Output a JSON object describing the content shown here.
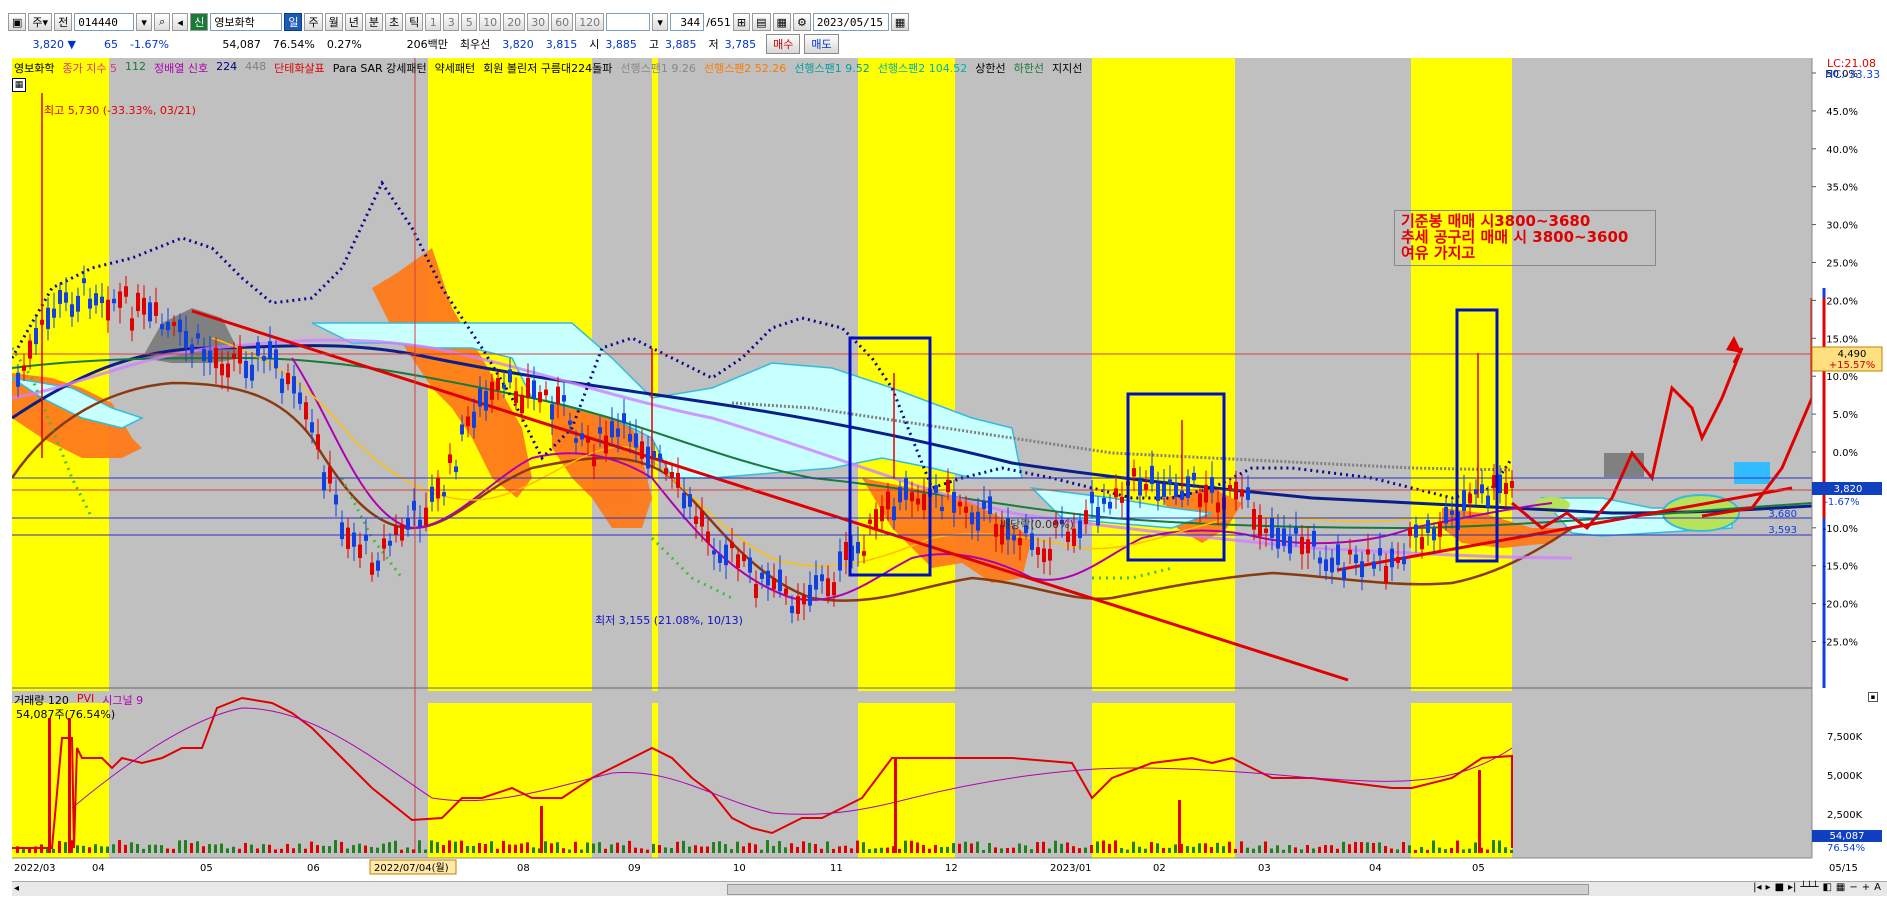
{
  "toolbar": {
    "period_buttons": [
      "주",
      "전"
    ],
    "code": "014440",
    "market_badge": "신",
    "stock_name": "영보화학",
    "interval_buttons": [
      "일",
      "주",
      "월",
      "년",
      "분",
      "초",
      "틱"
    ],
    "interval_numbers": [
      "1",
      "3",
      "5",
      "10",
      "20",
      "30",
      "60",
      "120"
    ],
    "count": "344",
    "total": "651",
    "date": "2023/05/15"
  },
  "info": {
    "price": "3,820 ▼",
    "change": "65",
    "change_pct": "-1.67%",
    "volume": "54,087",
    "vol_pct": "76.54%",
    "vol_change": "0.27%",
    "amount": "206백만",
    "quote": "최우선",
    "q1": "3,820",
    "q2": "3,815",
    "open_label": "시",
    "open": "3,885",
    "high_label": "고",
    "high": "3,885",
    "low_label": "저",
    "low": "3,785",
    "buy": "매수",
    "sell": "매도"
  },
  "legend": [
    {
      "text": "영보화학",
      "color": "#000000"
    },
    {
      "text": "종가 지수 5",
      "color": "#d63384"
    },
    {
      "text": "112",
      "color": "#1a7a3a"
    },
    {
      "text": "정배열 신호",
      "color": "#b000b0"
    },
    {
      "text": "224",
      "color": "#000080"
    },
    {
      "text": "448",
      "color": "#808080"
    },
    {
      "text": "단테화살표",
      "color": "#e00000"
    },
    {
      "text": "Para SAR 강세패턴",
      "color": "#000000"
    },
    {
      "text": "약세패턴",
      "color": "#000000"
    },
    {
      "text": "회원 볼린저 구름대224돌파",
      "color": "#000000"
    },
    {
      "text": "선행스팬1 9.26",
      "color": "#888888"
    },
    {
      "text": "선행스팬2 52.26",
      "color": "#ff7a00"
    },
    {
      "text": "선행스팬1 9.52",
      "color": "#00a0a0"
    },
    {
      "text": "선행스팬2 104.52",
      "color": "#00b0b0"
    },
    {
      "text": "상한선",
      "color": "#000000"
    },
    {
      "text": "하한선",
      "color": "#1a7a3a"
    },
    {
      "text": "지지선",
      "color": "#000000"
    }
  ],
  "legend_volume": [
    {
      "text": "거래량 120",
      "color": "#000000"
    },
    {
      "text": "PVI",
      "color": "#e00000"
    },
    {
      "text": "시그널 9",
      "color": "#b000b0"
    }
  ],
  "volume_readout": "54,087주(76.54%)",
  "annotations": {
    "high": "최고 5,730 (-33.33%, 03/21)",
    "low": "최저 3,155 (21.08%, 10/13)",
    "ex_div": "배당락(0.00%)",
    "note_lines": [
      "기준봉 매매 시3800~3680",
      "추세 공구리 매매 시 3800~3600",
      "여유 가지고"
    ]
  },
  "right_axis": {
    "lc": "LC:21.08",
    "hc": "HC:-33.33",
    "percent_ticks": [
      "50.0%",
      "45.0%",
      "40.0%",
      "35.0%",
      "30.0%",
      "25.0%",
      "20.0%",
      "15.0%",
      "10.0%",
      "5.0%",
      "0.0%",
      "-5.0%",
      "-10.0%",
      "-15.0%",
      "-20.0%",
      "-25.0%"
    ],
    "badge_price": "4,490",
    "badge_pct": "+15.57%",
    "current_price": "3,820",
    "current_pct": "-1.67%",
    "level1": "3,680",
    "level2": "3,593",
    "volume_ticks": [
      "7,500K",
      "5,000K",
      "2,500K"
    ],
    "vol_value": "54,087",
    "vol_pct": "76.54%"
  },
  "x_axis": {
    "labels": [
      "2022/03",
      "04",
      "05",
      "06",
      "2022/07/04(월)",
      "08",
      "09",
      "10",
      "11",
      "12",
      "2023/01",
      "02",
      "03",
      "04",
      "05",
      "05/15"
    ]
  },
  "colors": {
    "highlight": "#ffff00",
    "gray_bg": "#c0c0c0",
    "cloud_orange": "#ff7a1a",
    "cloud_cyan": "#c8ffff",
    "up_candle": "#e00000",
    "down_candle": "#1040e0"
  }
}
